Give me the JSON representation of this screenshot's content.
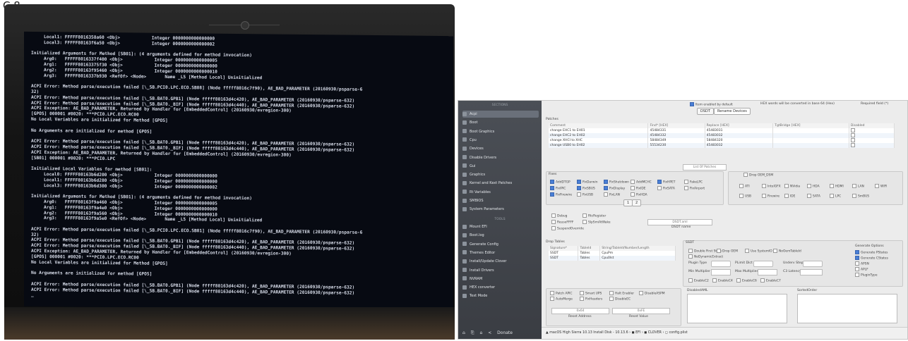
{
  "caption": "C 8",
  "terminal": {
    "lines": [
      {
        "t": "Local1: FFFFF8016358a60 <Obj>            Integer 0000000000000000",
        "i": true
      },
      {
        "t": "Local3: FFFFF80163f6a50 <Obj>            Integer 0000000000000002",
        "i": true
      },
      {
        "t": "",
        "i": false
      },
      {
        "t": "Initialized Arguments for Method [SB01]: (4 arguments defined for method invocation)",
        "i": false
      },
      {
        "t": "Arg0:   FFFFF8016337f400 <Obj>            Integer 0000000000000005",
        "i": true
      },
      {
        "t": "Arg1:   FFFFF80163375f30 <Obj>            Integer 0000000000000000",
        "i": true
      },
      {
        "t": "Arg2:   FFFFF80163f95460 <Obj>            Integer 0000000000000010",
        "i": true
      },
      {
        "t": "Arg3:   FFFFF8016337b930 <RefOf> <Node>       Name _L5 [Method Local] Uninitialized",
        "i": true
      },
      {
        "t": "",
        "i": false
      },
      {
        "t": "ACPI Error: Method parse/execution failed [\\_SB.PCI0.LPC.ECO.SB08] (Node fffff8016c7f90), AE_BAD_PARAMETER (20160930/psparse-6",
        "i": false
      },
      {
        "t": "32)",
        "i": false
      },
      {
        "t": "ACPI Error: Method parse/execution failed [\\_SB.BAT0.GPB1] (Node fffff80163d4c420), AE_BAD_PARAMETER (20160930/psparse-632)",
        "i": false
      },
      {
        "t": "ACPI Error: Method parse/execution failed [\\_SB.BAT0._BIF] (Node fffff80163d4c440), AE_BAD_PARAMETER (20160930/psparse-632)",
        "i": false
      },
      {
        "t": "ACPI Exception: AE_BAD_PARAMETER, Returned by Handler for [EmbeddedControl] (20160930/evregion-300)",
        "i": false
      },
      {
        "t": "[GPOS] 000001 #0020: ***PCI0.LPC.ECO.RC00",
        "i": false
      },
      {
        "t": "No Local Variables are initialized for Method [GPOS]",
        "i": false
      },
      {
        "t": "",
        "i": false
      },
      {
        "t": "No Arguments are initialized for method [GPOS]",
        "i": false
      },
      {
        "t": "",
        "i": false
      },
      {
        "t": "ACPI Error: Method parse/execution failed [\\_SB.BAT0.GPB1] (Node fffff80163d4c420), AE_BAD_PARAMETER (20160930/psparse-632)",
        "i": false
      },
      {
        "t": "ACPI Error: Method parse/execution failed [\\_SB.BAT0._BIF] (Node fffff80163d4c440), AE_BAD_PARAMETER (20160930/psparse-632)",
        "i": false
      },
      {
        "t": "ACPI Exception: AE_BAD_PARAMETER, Returned by Handler for [EmbeddedControl] (20160930/evregion-300)",
        "i": false
      },
      {
        "t": "[SB01] 000001 #0020: ***PCI0.LPC",
        "i": false
      },
      {
        "t": "",
        "i": false
      },
      {
        "t": "Initialized Local Variables for method [SB01]:",
        "i": false
      },
      {
        "t": "Local0: FFFFF80163b6d200 <Obj>            Integer 0000000000000000",
        "i": true
      },
      {
        "t": "Local1: FFFFF80163b6d280 <Obj>            Integer 0000000000000000",
        "i": true
      },
      {
        "t": "Local3: FFFFF80163b6d300 <Obj>            Integer 0000000000000002",
        "i": true
      },
      {
        "t": "",
        "i": false
      },
      {
        "t": "Initialized Arguments for Method [SB01]: (4 arguments defined for method invocation)",
        "i": false
      },
      {
        "t": "Arg0:   FFFFF80163f9a460 <Obj>            Integer 0000000000000005",
        "i": true
      },
      {
        "t": "Arg1:   FFFFF80163f9a4e0 <Obj>            Integer 0000000000000000",
        "i": true
      },
      {
        "t": "Arg2:   FFFFF80163f9a560 <Obj>            Integer 0000000000000010",
        "i": true
      },
      {
        "t": "Arg3:   FFFFF80163f9a5e0 <RefOf> <Node>       Name _L5 [Method Local] Uninitialized",
        "i": true
      },
      {
        "t": "",
        "i": false
      },
      {
        "t": "ACPI Error: Method parse/execution failed [\\_SB.PCI0.LPC.ECO.SB01] (Node fffff8016c7f90), AE_BAD_PARAMETER (20160930/psparse-6",
        "i": false
      },
      {
        "t": "32)",
        "i": false
      },
      {
        "t": "ACPI Error: Method parse/execution failed [\\_SB.BAT0.GPB1] (Node fffff80163d4c420), AE_BAD_PARAMETER (20160930/psparse-632)",
        "i": false
      },
      {
        "t": "ACPI Error: Method parse/execution failed [\\_SB.BAT0._BIF] (Node fffff80163d4c440), AE_BAD_PARAMETER (20160930/psparse-632)",
        "i": false
      },
      {
        "t": "ACPI Exception: AE_BAD_PARAMETER, Returned by Handler for [EmbeddedControl] (20160930/evregion-300)",
        "i": false
      },
      {
        "t": "[GPOS] 000001 #0020: ***PCI0.LPC.ECO.RC00",
        "i": false
      },
      {
        "t": "No Local Variables are initialized for Method [GPOS]",
        "i": false
      },
      {
        "t": "",
        "i": false
      },
      {
        "t": "No Arguments are initialized for method [GPOS]",
        "i": false
      },
      {
        "t": "",
        "i": false
      },
      {
        "t": "ACPI Error: Method parse/execution failed [\\_SB.BAT0.GPB1] (Node fffff80163d4c420), AE_BAD_PARAMETER (20160930/psparse-632)",
        "i": false
      },
      {
        "t": "ACPI Error: Method parse/execution failed [\\_SB.BAT0._BIF] (Node fffff80163d4c440), AE_BAD_PARAMETER (20160930/psparse-632)",
        "i": false
      },
      {
        "t": "_",
        "i": false
      }
    ]
  },
  "clover": {
    "sidebar": {
      "section_top": "SECTIONS",
      "items": [
        "Acpi",
        "Boot",
        "Boot Graphics",
        "Cpu",
        "Devices",
        "Disable Drivers",
        "Gui",
        "Graphics",
        "Kernel and Kext Patches",
        "Rt Variables",
        "SMBIOS",
        "System Parameters"
      ],
      "section_tools": "TOOLS",
      "tools": [
        "Mount EFI",
        "Boot.log",
        "Generate Config",
        "Themes Editor",
        "Install/Update Clover",
        "Install Drivers",
        "NVRAM",
        "HEX converter",
        "Text Mode"
      ],
      "bottom": [
        "⌂",
        "⎘",
        "⌂",
        "<",
        "Donate"
      ]
    },
    "header": {
      "auto_enabled": "Item enabled by default",
      "hex_note": "HEX words will be converted in base 64 (Hex)",
      "required": "Required field (*)",
      "tabs": [
        "DSDT",
        "Rename Devices"
      ]
    },
    "patches": {
      "title": "Patches",
      "columns": [
        "Comment",
        "Find* [HEX]",
        "Replace [HEX]",
        "TgtBridge [HEX]",
        "Disabled"
      ],
      "rows": [
        [
          "change EHC1 to EH01",
          "45484331",
          "45483031"
        ],
        [
          "change EHC2 to EH02",
          "45484332",
          "45483032"
        ],
        [
          "change XHCI to XHC",
          "58484349",
          "58484320"
        ],
        [
          "change USB0 to EH02",
          "55534230",
          "45483032"
        ]
      ],
      "list_label": "List Of Patches"
    },
    "fixes": {
      "title": "Fixes",
      "items": [
        "AddDTGP",
        "FixDarwin",
        "FixShutdown",
        "AddMCHC",
        "FixHPET",
        "FakeLPC",
        "FixIPIC",
        "FixSBUS",
        "FixDisplay",
        "FixIDE",
        "FixSATA",
        "FixAirport",
        "FixFirewire",
        "FixUSB",
        "FixLAN",
        "FixHDA"
      ],
      "page_buttons": [
        "1",
        "2"
      ]
    },
    "drop_oem": {
      "label": "Drop OEM_DSM",
      "items": [
        "ATI",
        "IntelGFX",
        "NVidia",
        "HDA",
        "HDMI",
        "LAN",
        "WIFI",
        "USB",
        "Firewire",
        "IDE",
        "SATA",
        "LPC",
        "SmBUS"
      ]
    },
    "debug": {
      "items": [
        "Debug",
        "RtcRegister",
        "ReuseFFFF",
        "SlpSmiAtWake",
        "SuspendOverride"
      ],
      "dsdt_name_label": "DSDT name",
      "dsdt_name_value": "DSDT.aml"
    },
    "drop_tables": {
      "title": "Drop Tables",
      "columns": [
        "Signature*",
        "TableId",
        "String/TableId/Number/Length"
      ],
      "rows": [
        [
          "SSDT",
          "Tables",
          "CpuPm"
        ],
        [
          "SSDT",
          "Tables",
          "Cpu0Ist"
        ]
      ]
    },
    "ssdt": {
      "title": "SSDT",
      "items": [
        "Double First State",
        "Drop OEM",
        "Use SystemIO",
        "NoOemTableId",
        "NoDynamicExtract"
      ],
      "plugin_type": "Plugin Type",
      "p_limit": "PLimit Dict",
      "underv": "Underv Step",
      "min_mult": "Min Multiplier",
      "max_mult": "Max Multiplier",
      "c3_latency": "C3 Latency",
      "enable_items": [
        "EnableC2",
        "EnableC4",
        "EnableC6",
        "EnableC7"
      ],
      "generate_title": "Generate Options",
      "generate": [
        "Generate PStates",
        "Generate CStates",
        "APSN",
        "APLF",
        "PluginType"
      ]
    },
    "bottom_left": {
      "items": [
        "Patch APIC",
        "Smart UPS",
        "Halt Enabler",
        "DisableASPM",
        "AutoMerge",
        "FixHeaders",
        "DisableEC"
      ],
      "reset_address": "Reset Address",
      "reset_value": "Reset Value",
      "reset_address_ph": "0x64",
      "reset_value_ph": "0xFE"
    },
    "disabled_aml": "DisabledAML",
    "sorted_order": "SortedOrder",
    "statusbar": "▲ macOS High Sierra 10.13 Install Disk - 10.13.6 › ◼ EFI › ◼ CLOVER › ◻ config.plist"
  }
}
